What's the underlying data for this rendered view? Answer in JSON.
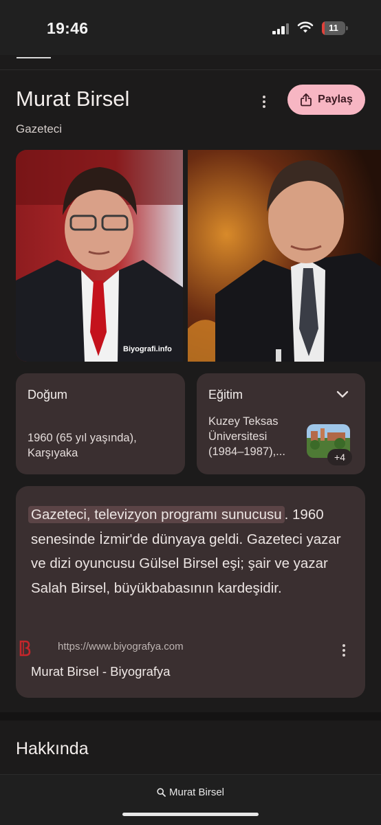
{
  "status_bar": {
    "time": "19:46",
    "battery_level": "11",
    "battery_color": "#e0413a"
  },
  "knowledge_panel": {
    "title": "Murat Birsel",
    "subtitle": "Gazeteci",
    "share_label": "Paylaş",
    "share_color": "#f7b6c3"
  },
  "photos": [
    {
      "watermark": "Biyografi.info"
    },
    {
      "watermark": ""
    }
  ],
  "info_cards": {
    "birth": {
      "label": "Doğum",
      "value": "1960 (65 yıl yaşında), Karşıyaka"
    },
    "education": {
      "label": "Eğitim",
      "value": "Kuzey Teksas\nÜniversitesi\n(1984–1987),...",
      "more_count": "+4"
    }
  },
  "description": {
    "highlight": "Gazeteci, televizyon programı sunucusu",
    "text": ". 1960 senesinde İzmir'de dünyaya geldi. Gazeteci yazar ve dizi oyuncusu Gülsel Birsel eşi; şair ve yazar Salah Birsel, büyükbabasının kardeşidir.",
    "source_url": "https://www.biyografya.com",
    "source_title": "Murat Birsel - Biyografya",
    "source_icon": "biyografya-logo-icon"
  },
  "sections": {
    "about_title": "Hakkında"
  },
  "bottom_bar": {
    "query": "Murat Birsel"
  }
}
